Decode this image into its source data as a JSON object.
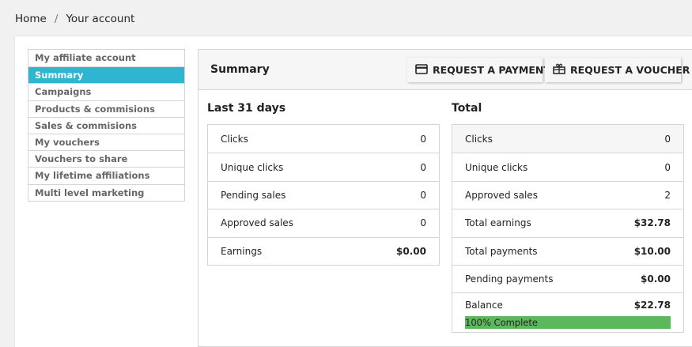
{
  "breadcrumb": {
    "home": "Home",
    "separator": "/",
    "current": "Your account"
  },
  "sidebar": {
    "items": [
      {
        "label": "My affiliate account",
        "active": false
      },
      {
        "label": "Summary",
        "active": true
      },
      {
        "label": "Campaigns",
        "active": false
      },
      {
        "label": "Products & commisions",
        "active": false
      },
      {
        "label": "Sales & commisions",
        "active": false
      },
      {
        "label": "My vouchers",
        "active": false
      },
      {
        "label": "Vouchers to share",
        "active": false
      },
      {
        "label": "My lifetime affiliations",
        "active": false
      },
      {
        "label": "Multi level marketing",
        "active": false
      }
    ]
  },
  "panel": {
    "title": "Summary",
    "buttons": {
      "payment": "REQUEST A PAYMENT",
      "voucher": "REQUEST A VOUCHER"
    }
  },
  "last31": {
    "title": "Last 31 days",
    "rows": [
      {
        "label": "Clicks",
        "value": "0"
      },
      {
        "label": "Unique clicks",
        "value": "0"
      },
      {
        "label": "Pending sales",
        "value": "0"
      },
      {
        "label": "Approved sales",
        "value": "0"
      },
      {
        "label": "Earnings",
        "value": "$0.00"
      }
    ]
  },
  "total": {
    "title": "Total",
    "rows": [
      {
        "label": "Clicks",
        "value": "0"
      },
      {
        "label": "Unique clicks",
        "value": "0"
      },
      {
        "label": "Approved sales",
        "value": "2"
      },
      {
        "label": "Total earnings",
        "value": "$32.78"
      },
      {
        "label": "Total payments",
        "value": "$10.00"
      },
      {
        "label": "Pending payments",
        "value": "$0.00"
      }
    ],
    "balance": {
      "label": "Balance",
      "value": "$22.78"
    },
    "progress": {
      "percent": 100,
      "text": "100% Complete"
    }
  },
  "colors": {
    "accent": "#2fb5d2",
    "progress": "#5cb85c",
    "text": "#232323"
  },
  "icons": {
    "payment": "credit-card-icon",
    "voucher": "gift-icon"
  }
}
